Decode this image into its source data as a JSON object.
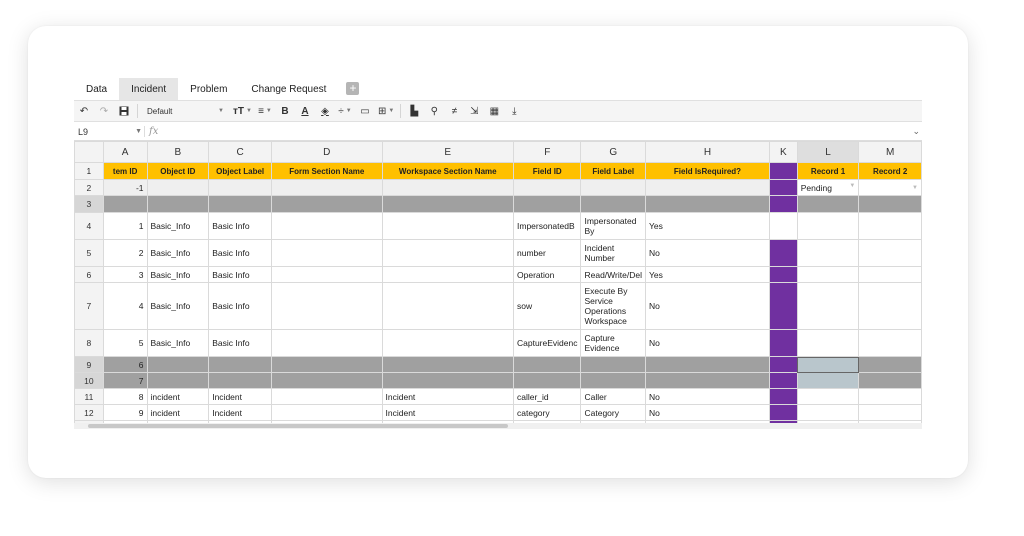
{
  "sheet_tabs": [
    {
      "label": "Data",
      "active": false
    },
    {
      "label": "Incident",
      "active": true
    },
    {
      "label": "Problem",
      "active": false
    },
    {
      "label": "Change Request",
      "active": false
    }
  ],
  "toolbar": {
    "font": "Default"
  },
  "formula_bar": {
    "cell_ref": "L9",
    "fx": "fx",
    "value": ""
  },
  "columns": [
    "A",
    "B",
    "C",
    "D",
    "E",
    "F",
    "G",
    "H",
    "K",
    "L",
    "M"
  ],
  "header_row": [
    "tem ID",
    "Object ID",
    "Object Label",
    "Form Section Name",
    "Workspace Section Name",
    "Field ID",
    "Field Label",
    "Field IsRequired?",
    "",
    "Record 1",
    "Record 2"
  ],
  "row2": {
    "a": "-1",
    "l": "Pending"
  },
  "rows": [
    {
      "num": "4",
      "id": "1",
      "obj": "Basic_Info",
      "label": "Basic Info",
      "form": "",
      "ws": "",
      "field": "ImpersonatedB",
      "flabel": "Impersonated By",
      "req": "Yes"
    },
    {
      "num": "5",
      "id": "2",
      "obj": "Basic_Info",
      "label": "Basic Info",
      "form": "",
      "ws": "",
      "field": "number",
      "flabel": "Incident Number",
      "req": "No"
    },
    {
      "num": "6",
      "id": "3",
      "obj": "Basic_Info",
      "label": "Basic Info",
      "form": "",
      "ws": "",
      "field": "Operation",
      "flabel": "Read/Write/Del",
      "req": "Yes"
    },
    {
      "num": "7",
      "id": "4",
      "obj": "Basic_Info",
      "label": "Basic Info",
      "form": "",
      "ws": "",
      "field": "sow",
      "flabel": "Execute By Service Operations Workspace",
      "req": "No"
    },
    {
      "num": "8",
      "id": "5",
      "obj": "Basic_Info",
      "label": "Basic Info",
      "form": "",
      "ws": "",
      "field": "CaptureEvidenc",
      "flabel": "Capture Evidence",
      "req": "No"
    }
  ],
  "gray_rows": [
    {
      "num": "9",
      "id": "6"
    },
    {
      "num": "10",
      "id": "7"
    }
  ],
  "rows_bottom": [
    {
      "num": "11",
      "id": "8",
      "obj": "incident",
      "label": "Incident",
      "form": "",
      "ws": "Incident",
      "field": "caller_id",
      "flabel": "Caller",
      "req": "No"
    },
    {
      "num": "12",
      "id": "9",
      "obj": "incident",
      "label": "Incident",
      "form": "",
      "ws": "Incident",
      "field": "category",
      "flabel": "Category",
      "req": "No"
    }
  ],
  "row_numbers": {
    "r1": "1",
    "r2": "2",
    "r3": "3"
  },
  "colors": {
    "header_fill": "#ffc000",
    "purple": "#7030a0",
    "gray_row": "#a0a0a0"
  }
}
